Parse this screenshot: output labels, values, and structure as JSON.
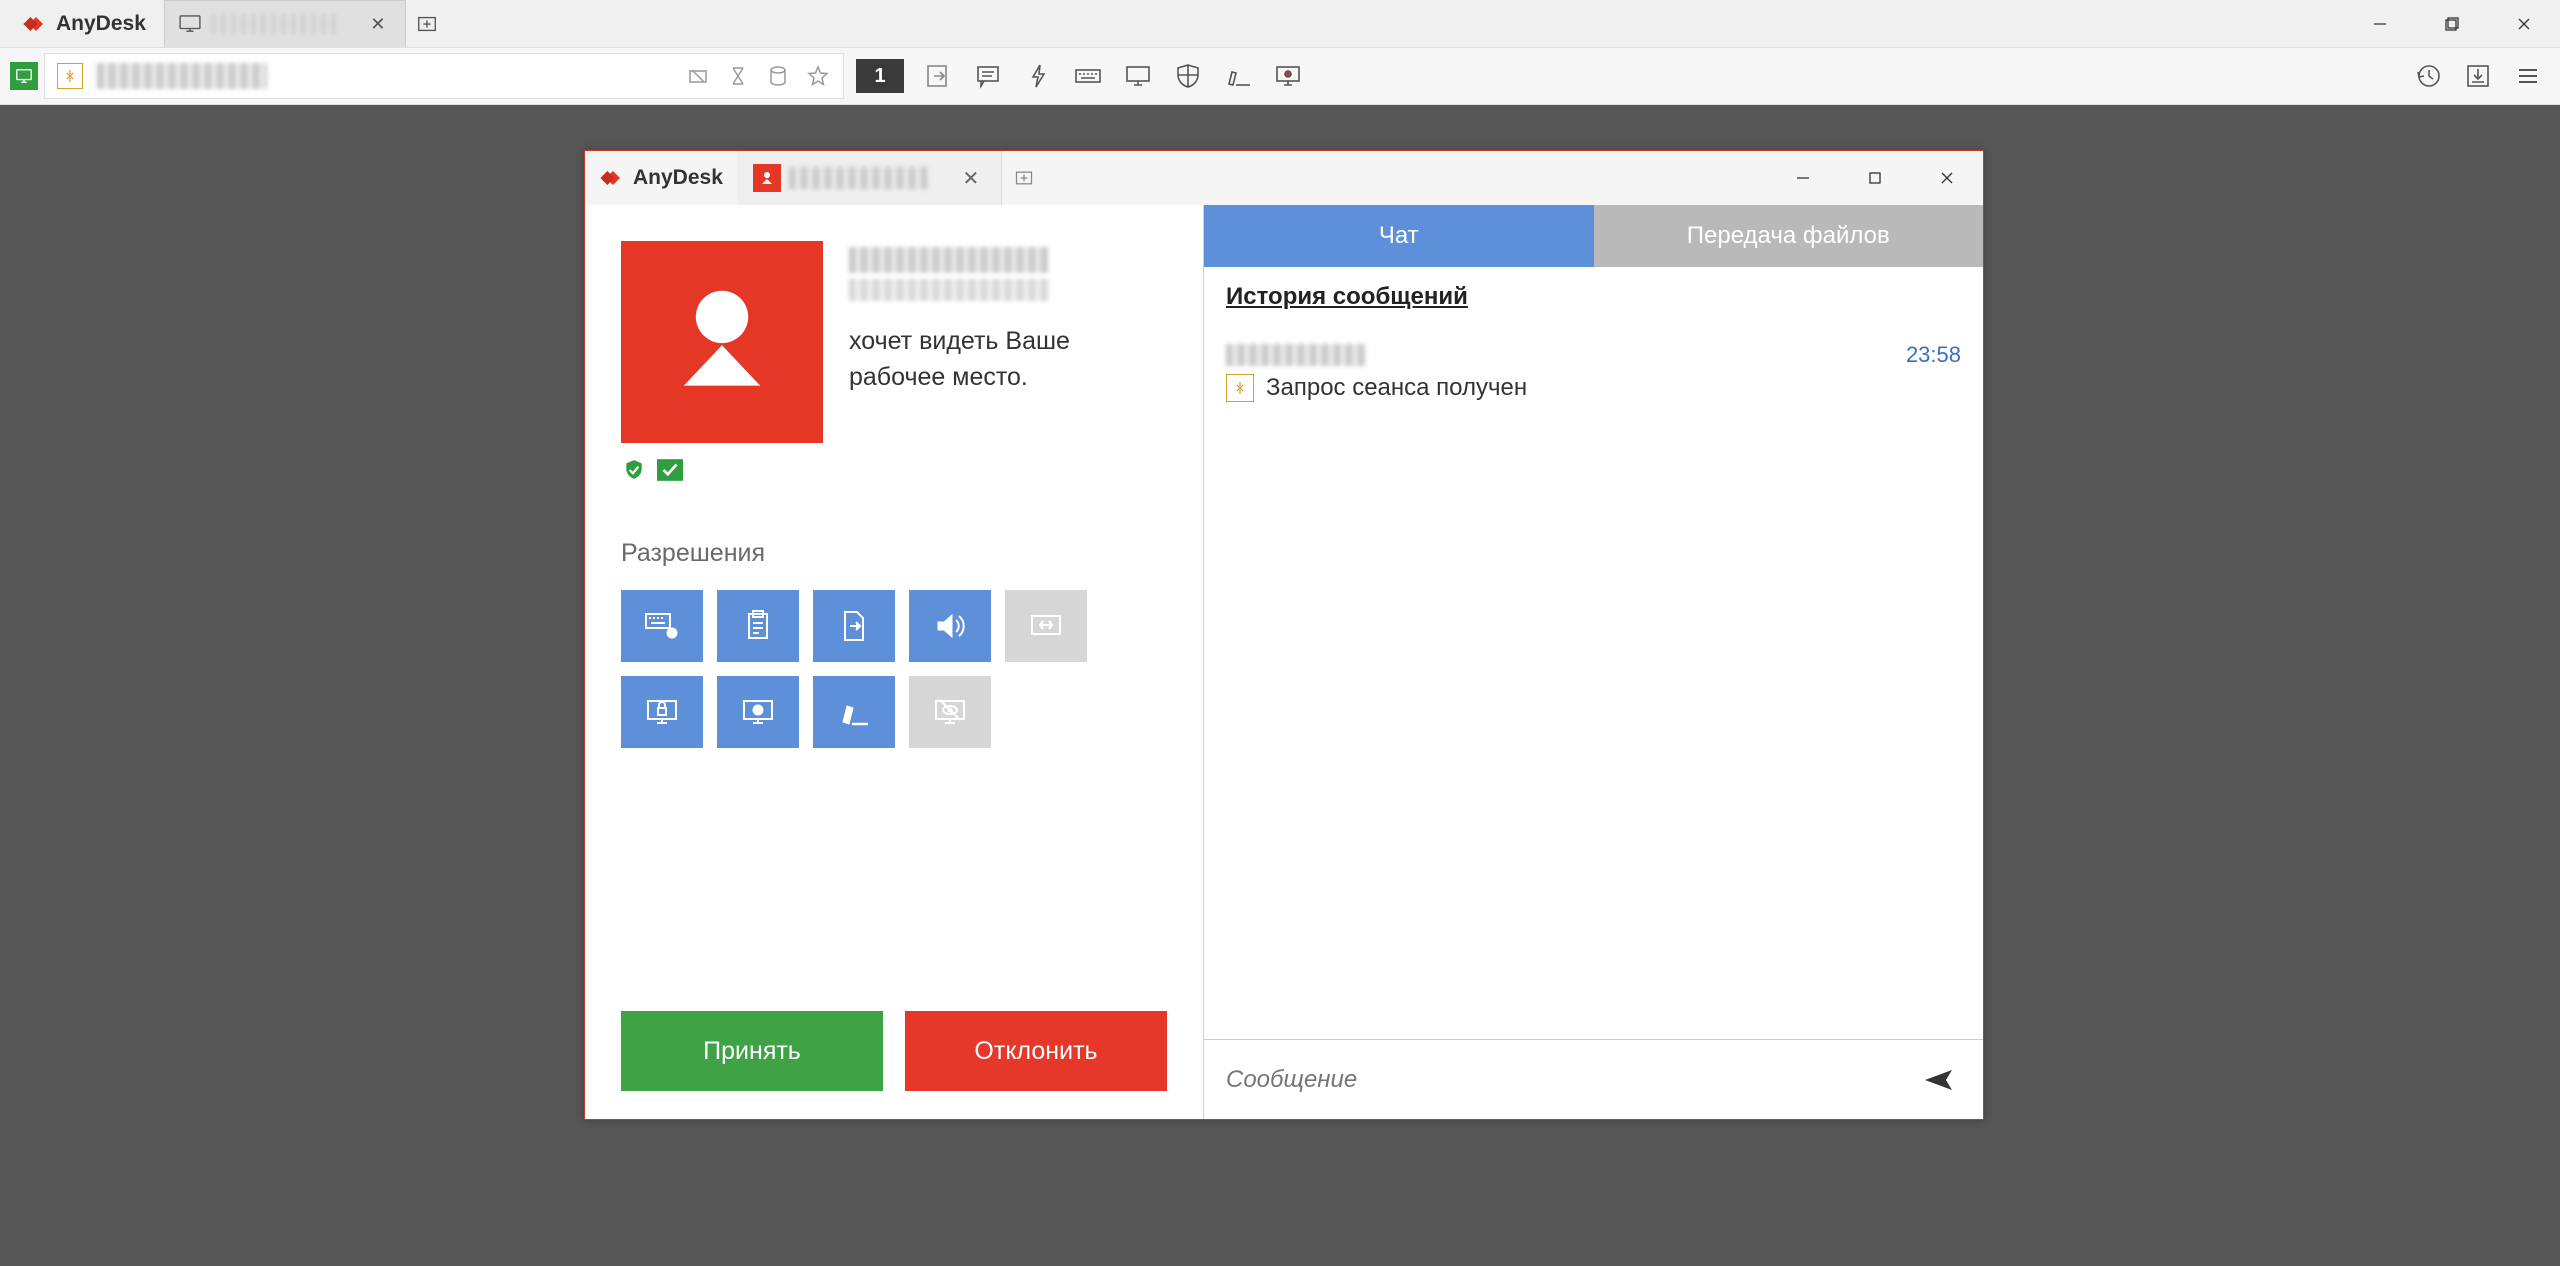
{
  "app": {
    "name": "AnyDesk"
  },
  "main_tab": {
    "label_obscured": true
  },
  "toolbar": {
    "display_number": "1"
  },
  "popup": {
    "app_name": "AnyDesk",
    "tab_obscured": true,
    "requester_name_obscured": true,
    "requester_id_obscured": true,
    "wants_text_line1": "хочет видеть Ваше",
    "wants_text_line2": "рабочее место.",
    "permissions_title": "Разрешения",
    "accept_label": "Принять",
    "reject_label": "Отклонить",
    "chat": {
      "tab_chat": "Чат",
      "tab_files": "Передача файлов",
      "history_title": "История сообщений",
      "message": {
        "sender_obscured": true,
        "time": "23:58",
        "text": "Запрос сеанса получен"
      },
      "input_placeholder": "Сообщение"
    }
  }
}
